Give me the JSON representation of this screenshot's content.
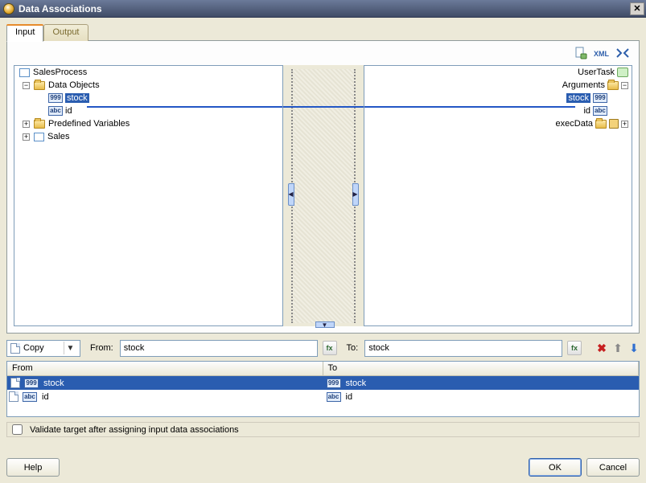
{
  "window": {
    "title": "Data Associations"
  },
  "tabs": {
    "input": "Input",
    "output": "Output",
    "active": "input"
  },
  "toolbar": {
    "db_icon": "db-expr-icon",
    "xml_icon": "xml-icon",
    "map_icon": "automap-icon"
  },
  "left_tree": {
    "root": "SalesProcess",
    "data_objects": {
      "label": "Data Objects",
      "items": [
        {
          "name": "stock",
          "type": "999",
          "selected": true
        },
        {
          "name": "id",
          "type": "abc",
          "selected": false
        }
      ]
    },
    "predefined": "Predefined Variables",
    "sales": "Sales"
  },
  "right_tree": {
    "root": "UserTask",
    "arguments": {
      "label": "Arguments",
      "items": [
        {
          "name": "stock",
          "type": "999",
          "selected": true
        },
        {
          "name": "id",
          "type": "abc",
          "selected": false
        }
      ]
    },
    "exec": "execData"
  },
  "mapping": {
    "mode_label": "Copy",
    "from_label": "From:",
    "from_value": "stock",
    "to_label": "To:",
    "to_value": "stock",
    "delete_icon": "delete",
    "up_icon": "move-up",
    "down_icon": "move-down"
  },
  "grid": {
    "col_from": "From",
    "col_to": "To",
    "rows": [
      {
        "from": "stock",
        "from_type": "999",
        "to": "stock",
        "to_type": "999",
        "selected": true
      },
      {
        "from": "id",
        "from_type": "abc",
        "to": "id",
        "to_type": "abc",
        "selected": false
      }
    ]
  },
  "validate": {
    "label": "Validate target after assigning input data associations",
    "checked": false
  },
  "buttons": {
    "help": "Help",
    "ok": "OK",
    "cancel": "Cancel"
  }
}
